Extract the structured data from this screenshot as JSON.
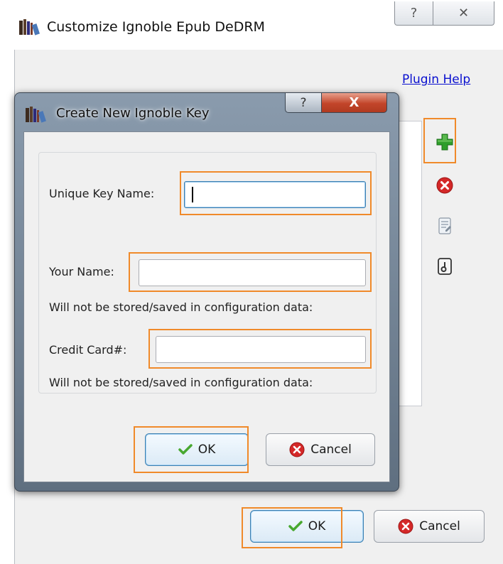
{
  "parent_window": {
    "title": "Customize Ignoble Epub DeDRM",
    "help_glyph": "?",
    "close_glyph": "✕",
    "plugin_help": "Plugin Help",
    "ok_label": "OK",
    "cancel_label": "Cancel",
    "side_buttons": [
      "add-key-icon",
      "remove-key-icon",
      "rename-key-icon",
      "export-key-icon"
    ]
  },
  "dialog": {
    "title": "Create New Ignoble Key",
    "help_glyph": "?",
    "close_glyph": "X",
    "unique_key_label": "Unique Key Name:",
    "unique_key_value": "",
    "your_name_label": "Your Name:",
    "your_name_value": "",
    "your_name_hint": "Will not be stored/saved in configuration data:",
    "credit_card_label": "Credit Card#:",
    "credit_card_value": "",
    "credit_card_hint": "Will not be stored/saved in configuration data:",
    "ok_label": "OK",
    "cancel_label": "Cancel"
  },
  "colors": {
    "highlight": "#f08a2a",
    "link": "#0a10cf",
    "add_green": "#2e9e2a",
    "cancel_red": "#d42828",
    "check_green": "#48a830"
  }
}
